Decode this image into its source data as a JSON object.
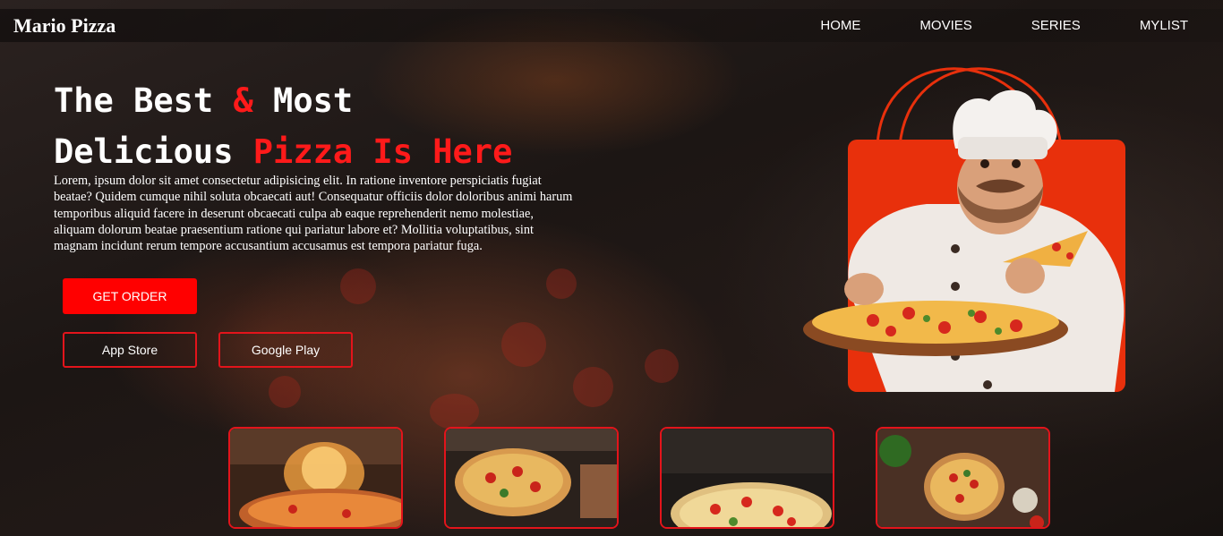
{
  "brand": {
    "name": "Mario Pizza"
  },
  "nav": {
    "items": [
      "HOME",
      "MOVIES",
      "SERIES",
      "MYLIST"
    ]
  },
  "hero": {
    "headline_part1": "The Best ",
    "headline_amp": "&",
    "headline_part2": " Most",
    "headline_line2": "Delicious ",
    "headline_highlight": "Pizza Is Here",
    "description": "Lorem, ipsum dolor sit amet consectetur adipisicing elit. In ratione inventore perspiciatis fugiat beatae? Quidem cumque nihil soluta obcaecati aut! Consequatur officiis dolor doloribus animi harum temporibus aliquid facere in deserunt obcaecati culpa ab eaque reprehenderit nemo molestiae, aliquam dolorum beatae praesentium ratione qui pariatur labore et? Mollitia voluptatibus, sint magnam incidunt rerum tempore accusantium accusamus est tempora pariatur fuga.",
    "order_button": "GET ORDER",
    "app_store_button": "App Store",
    "google_play_button": "Google Play"
  },
  "colors": {
    "accent": "#ff0000",
    "border": "#e3141b",
    "bag": "#e8300c"
  },
  "gallery": [
    {
      "icon": "pizza-oven-flames-image",
      "label": ""
    },
    {
      "icon": "pizza-into-oven-image",
      "label": ""
    },
    {
      "icon": "pizza-in-oven-image",
      "label": ""
    },
    {
      "icon": "pizza-topview-image",
      "label": ""
    }
  ]
}
